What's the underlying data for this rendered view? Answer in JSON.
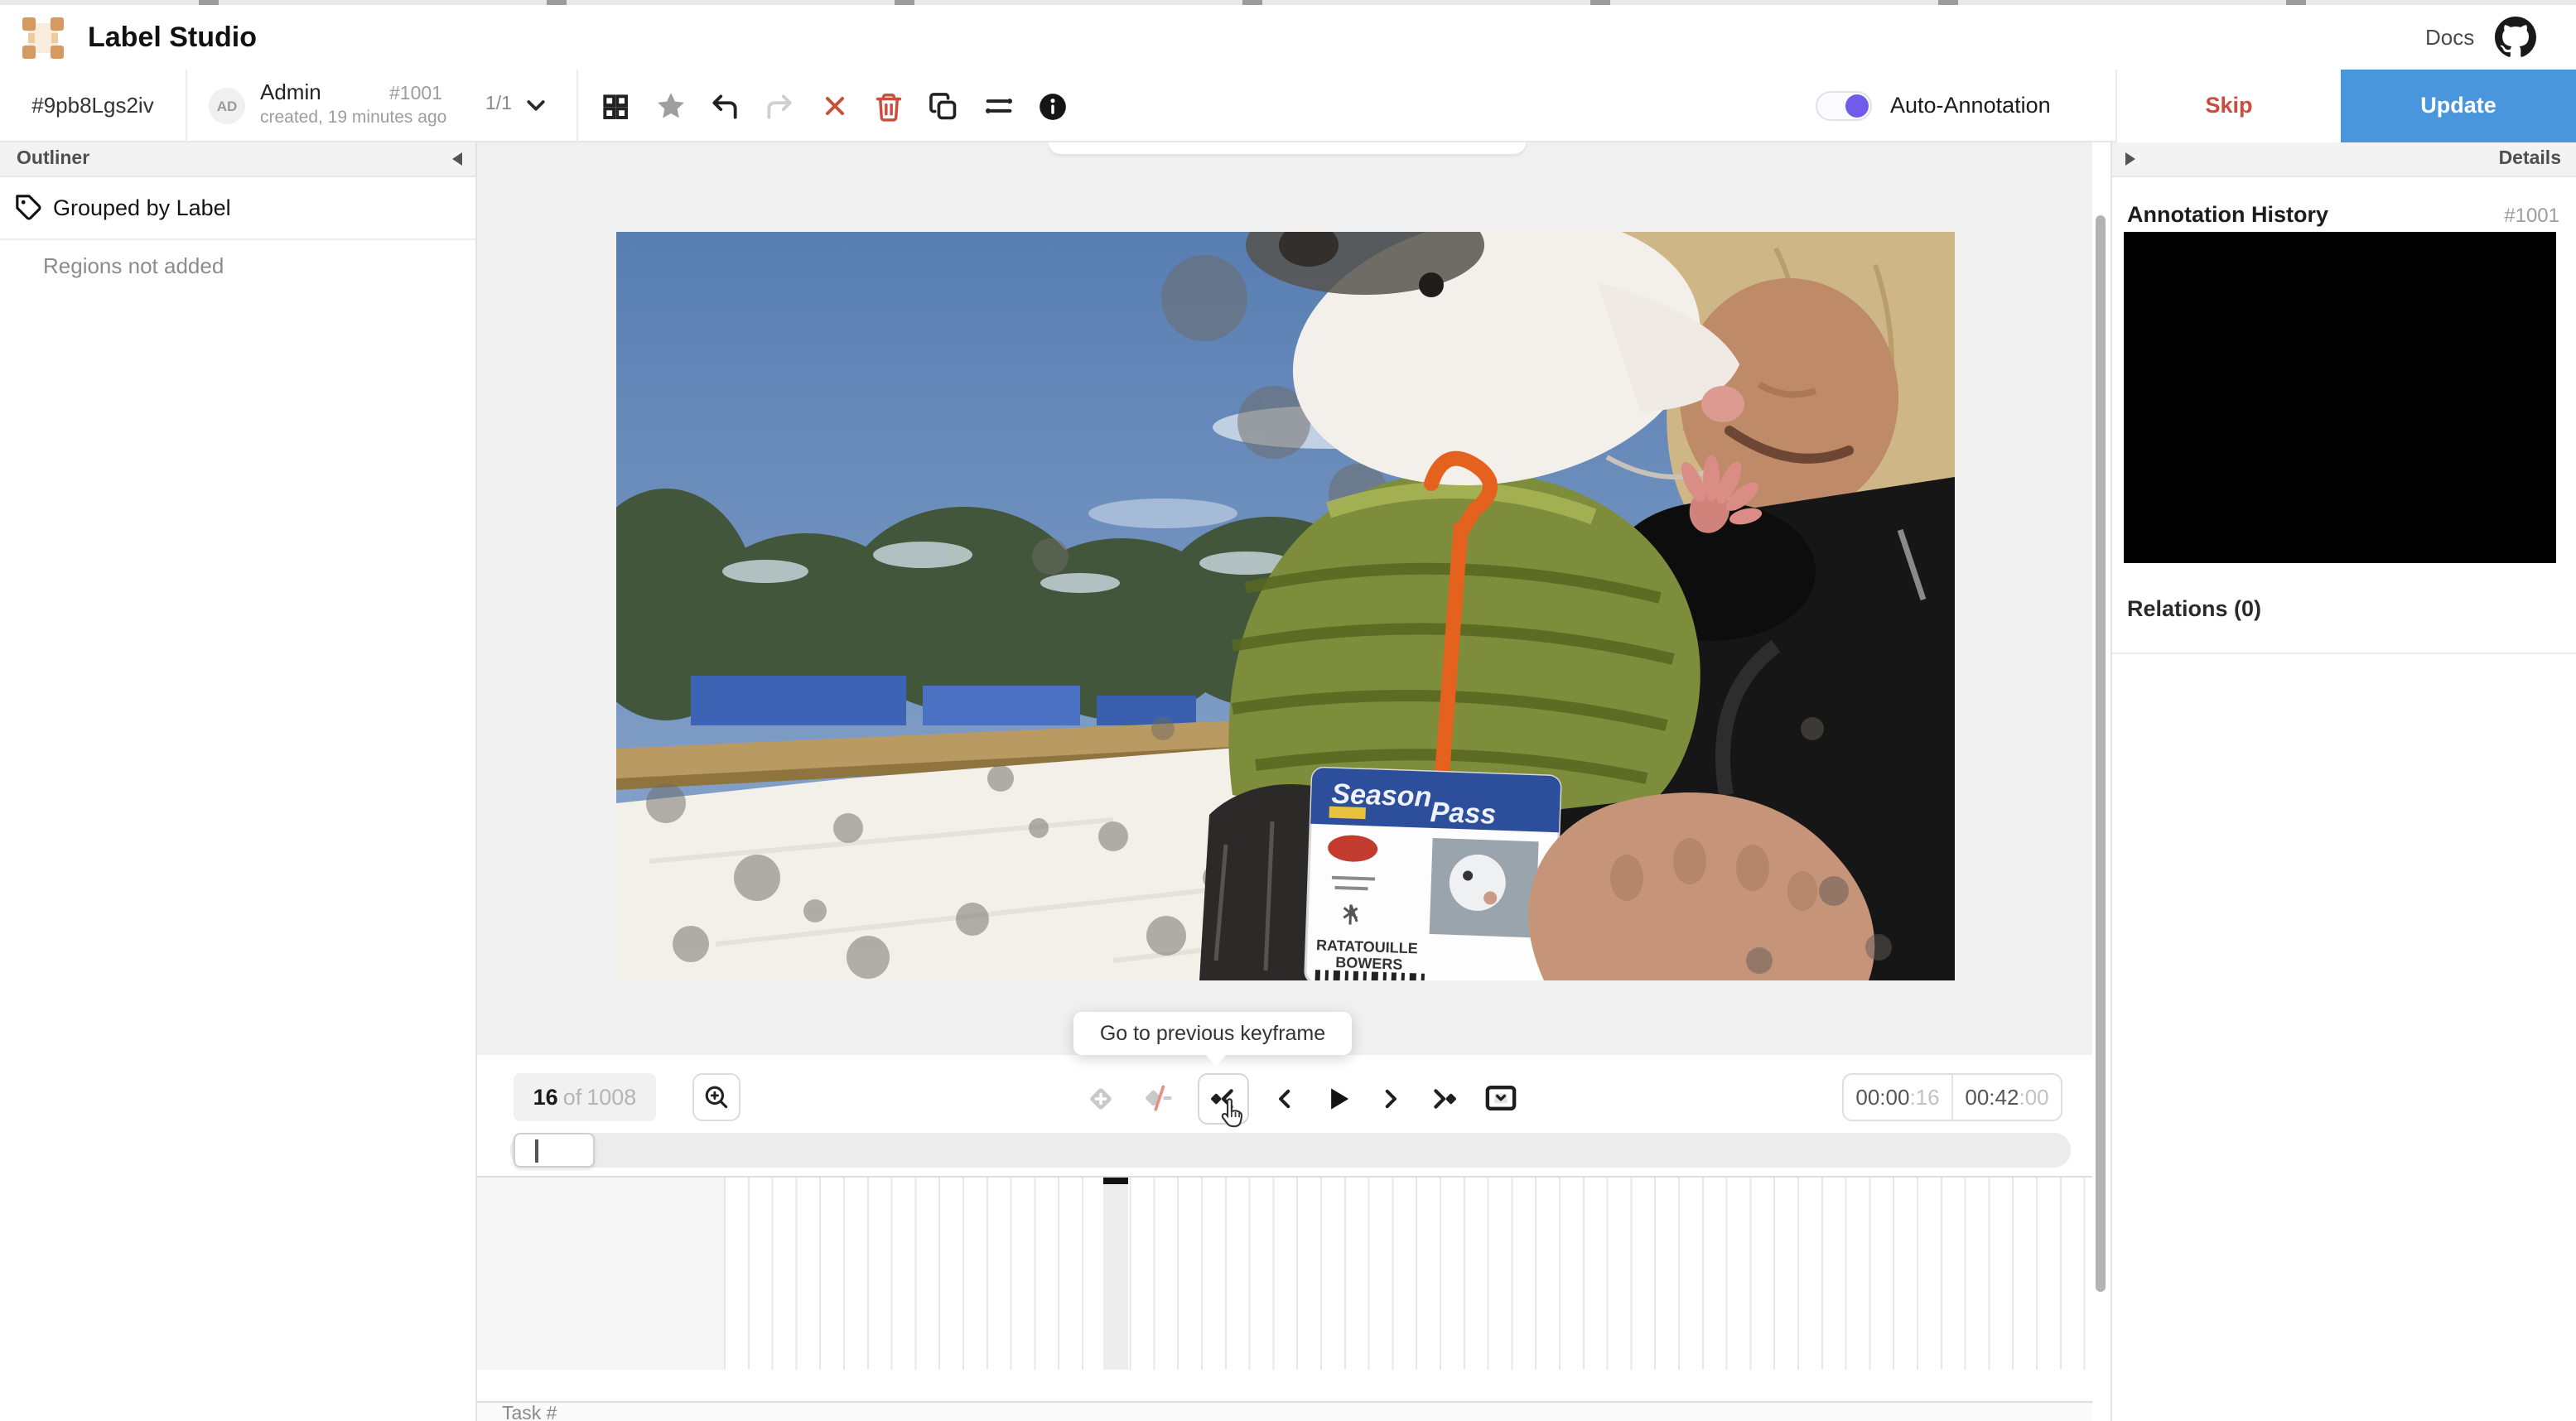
{
  "header": {
    "app_title": "Label Studio",
    "docs": "Docs",
    "github_icon": "github-icon",
    "logo_icon": "label-studio-logo"
  },
  "task_bar": {
    "task_id": "#9pb8Lgs2iv",
    "user_initials": "AD",
    "user_name": "Admin",
    "annotation_id": "#1001",
    "created": "created, 19 minutes ago",
    "pager": "1/1",
    "toolbar_icons": [
      "grid-view-icon",
      "star-icon",
      "undo-icon",
      "redo-icon",
      "reset-icon",
      "delete-icon",
      "duplicate-icon",
      "relations-icon",
      "info-icon"
    ]
  },
  "annotation_actions": {
    "auto_annotation": "Auto-Annotation",
    "skip": "Skip",
    "update": "Update"
  },
  "outliner": {
    "title": "Outliner",
    "grouping": "Grouped by Label",
    "empty": "Regions not added"
  },
  "details_panel": {
    "title": "Details",
    "annotation_history": "Annotation History",
    "annotation_id": "#1001",
    "relations": "Relations (0)"
  },
  "video_player": {
    "frame_current": "16",
    "frame_of": "of",
    "frame_total": "1008",
    "tooltip": "Go to previous keyframe",
    "time_position_main": "00:00",
    "time_position_frames": ":16",
    "time_length_main": "00:42",
    "time_length_frames": ":00",
    "control_icons": [
      "zoom-in-icon",
      "keyframe-add-icon",
      "keyframe-interpolation-icon",
      "previous-keyframe-icon",
      "previous-frame-icon",
      "play-icon",
      "next-frame-icon",
      "next-keyframe-icon",
      "frame-options-icon"
    ]
  },
  "video_scene": {
    "badge_line1": "Season",
    "badge_line2": "Pass",
    "badge_name1": "RATATOUILLE",
    "badge_name2": "BOWERS"
  },
  "footer": {
    "task_label": "Task #"
  },
  "colors": {
    "accent_blue": "#4a96dd",
    "danger_red": "#ce4a3b",
    "toggle_purple": "#6f5cea",
    "logo_tan": "#d49a62",
    "star_gray": "#9e9e9e"
  }
}
